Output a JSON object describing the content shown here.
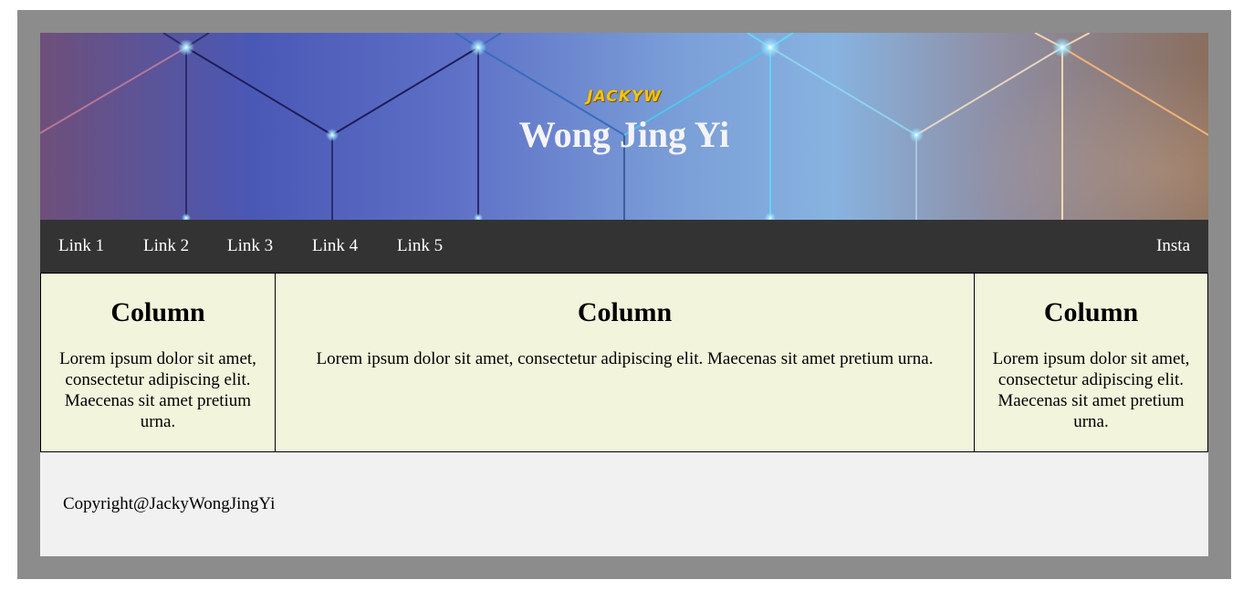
{
  "header": {
    "logo_text": "JACKYW",
    "title": "Wong Jing Yi"
  },
  "nav": {
    "links": [
      "Link 1",
      "Link 2",
      "Link 3",
      "Link 4",
      "Link 5"
    ],
    "right_link": "Insta"
  },
  "columns": [
    {
      "heading": "Column",
      "text": "Lorem ipsum dolor sit amet, consectetur adipiscing elit. Maecenas sit amet pretium urna."
    },
    {
      "heading": "Column",
      "text": "Lorem ipsum dolor sit amet, consectetur adipiscing elit. Maecenas sit amet pretium urna."
    },
    {
      "heading": "Column",
      "text": "Lorem ipsum dolor sit amet, consectetur adipiscing elit. Maecenas sit amet pretium urna."
    }
  ],
  "footer": {
    "copyright": "Copyright@JackyWongJingYi"
  },
  "colors": {
    "frame": "#8c8c8c",
    "nav_bg": "#333333",
    "column_bg": "#f3f4dc",
    "footer_bg": "#f1f1f1",
    "logo": "#f2c318"
  }
}
